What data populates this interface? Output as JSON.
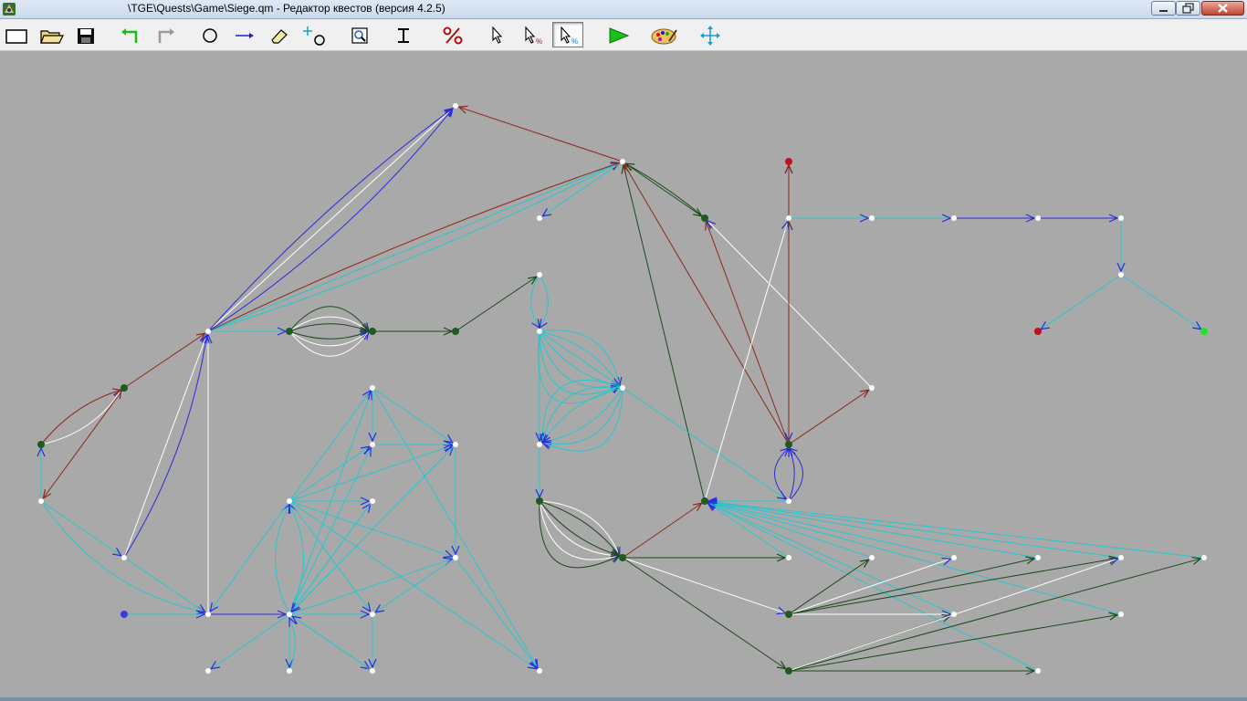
{
  "window": {
    "title": "\\TGE\\Quests\\Game\\Siege.qm - Редактор квестов (версия 4.2.5)",
    "app_icon": "quest-editor-icon",
    "buttons": [
      "minimize",
      "maximize",
      "close"
    ]
  },
  "toolbar": [
    {
      "name": "new-button",
      "icon": "new-document-icon"
    },
    {
      "name": "open-button",
      "icon": "folder-open-icon"
    },
    {
      "name": "save-button",
      "icon": "floppy-disk-icon"
    },
    {
      "name": "undo-button",
      "icon": "undo-arrow-icon"
    },
    {
      "name": "redo-button",
      "icon": "redo-arrow-icon"
    },
    {
      "name": "add-location-button",
      "icon": "circle-icon"
    },
    {
      "name": "add-path-button",
      "icon": "arrow-right-icon"
    },
    {
      "name": "eraser-button",
      "icon": "eraser-icon"
    },
    {
      "name": "move-location-button",
      "icon": "move-circle-icon"
    },
    {
      "name": "zoom-button",
      "icon": "magnifier-icon"
    },
    {
      "name": "text-button",
      "icon": "text-cursor-icon"
    },
    {
      "name": "parameters-button",
      "icon": "percent-icon"
    },
    {
      "name": "select-button",
      "icon": "pointer-icon"
    },
    {
      "name": "select-percent-button",
      "icon": "pointer-percent-icon"
    },
    {
      "name": "select-percent-alt-button",
      "icon": "pointer-percent-icon",
      "pressed": true
    },
    {
      "name": "run-button",
      "icon": "play-icon"
    },
    {
      "name": "palette-button",
      "icon": "palette-icon"
    },
    {
      "name": "pan-button",
      "icon": "move-arrows-icon"
    }
  ],
  "graph": {
    "edge_colors": {
      "cyan": "#26c6cf",
      "blue": "#2b2bdd",
      "dark_green": "#1c4a1c",
      "dark_red": "#8b2a1a",
      "white": "#ffffff",
      "tan": "#c98a5a"
    },
    "node_colors": {
      "normal": "#ffffff",
      "dark": "#1f5a1f",
      "start": "#3b3be0",
      "fail": "#c0101c",
      "win": "#22e022"
    }
  }
}
